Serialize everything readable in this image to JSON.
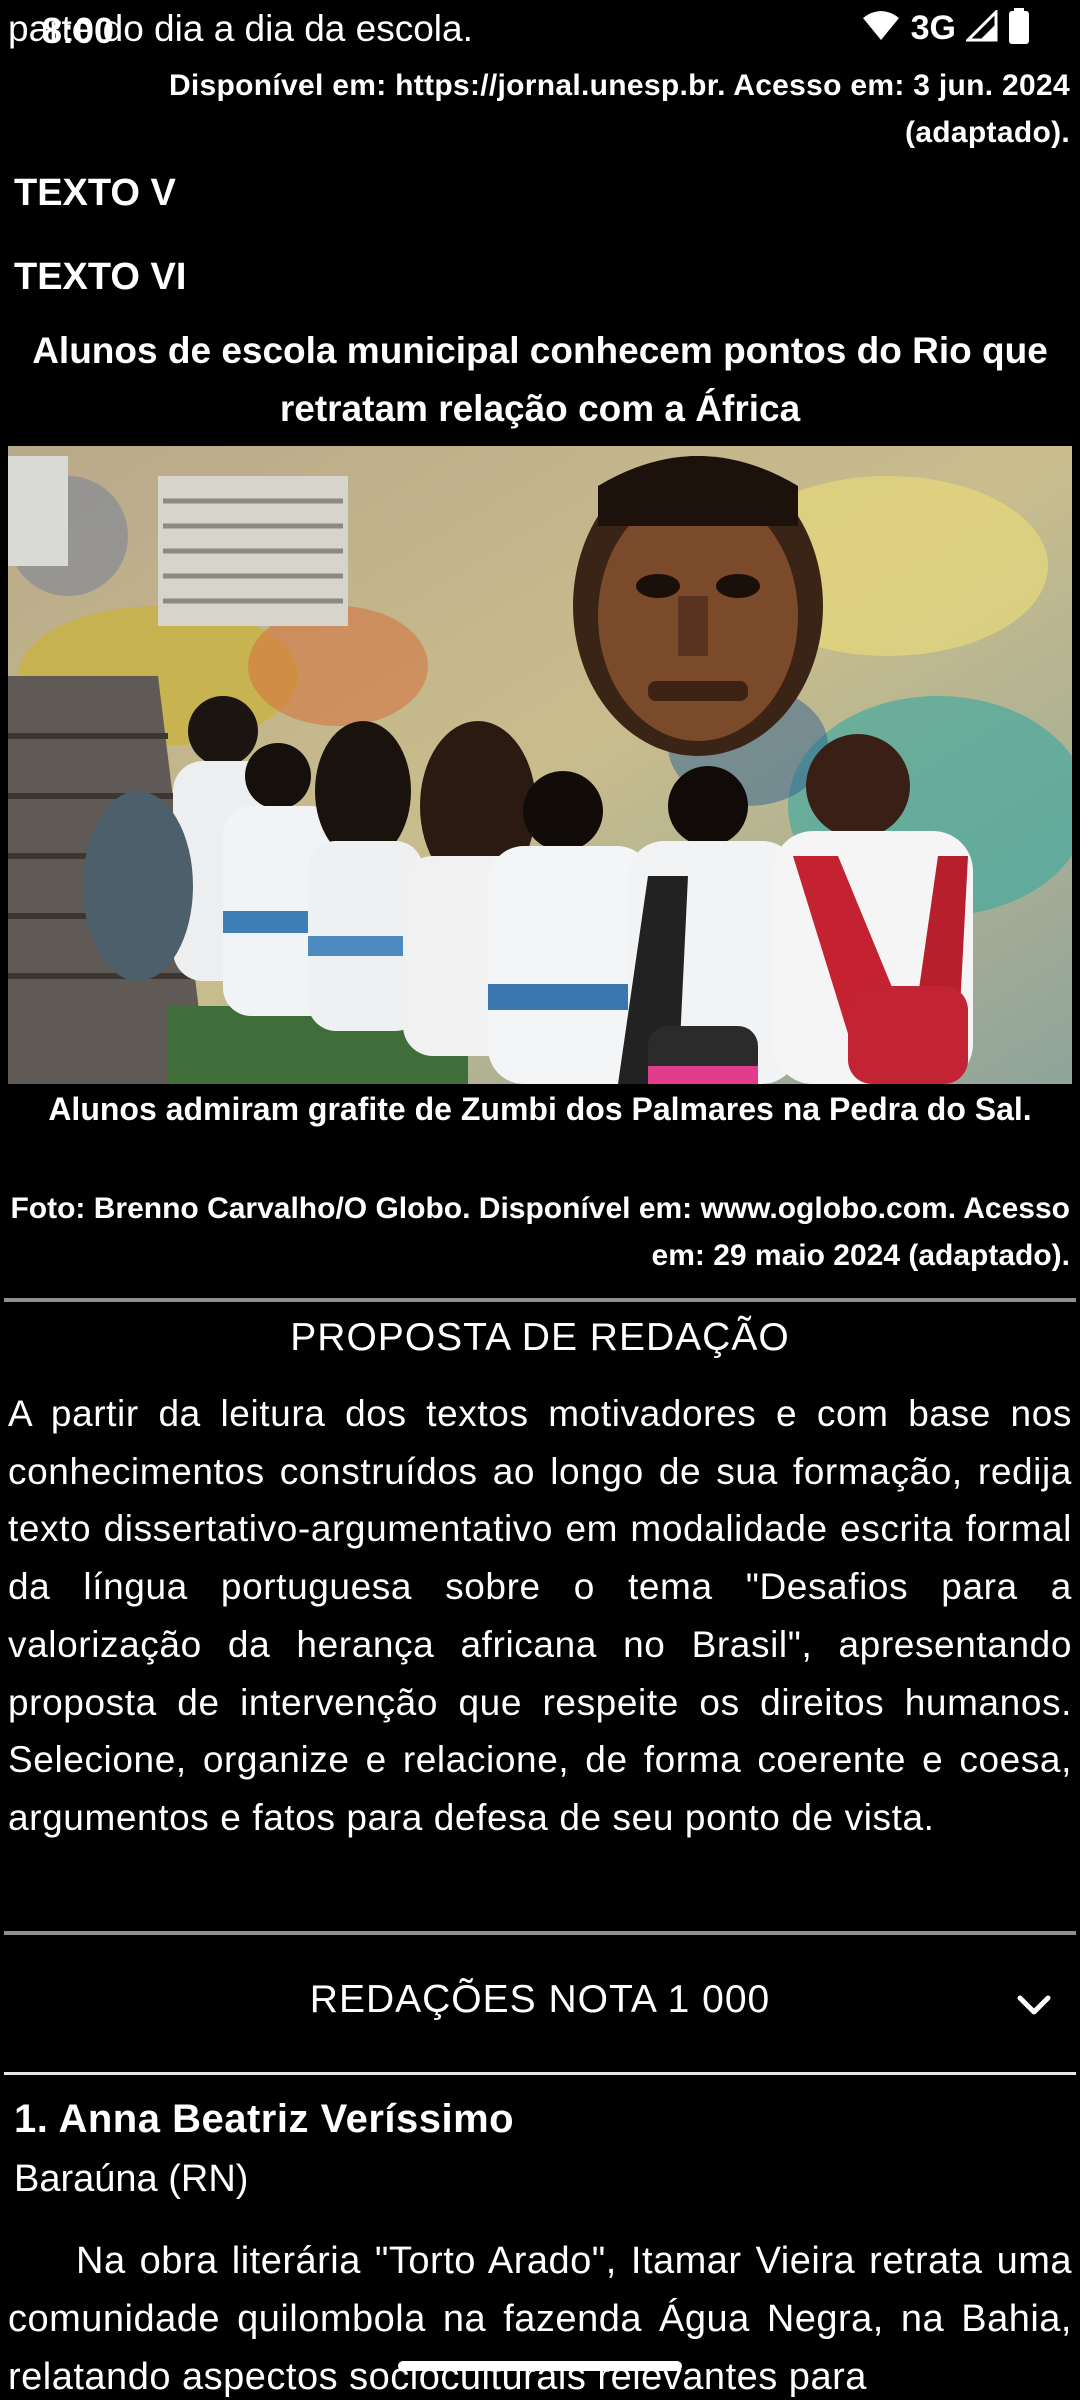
{
  "status_bar": {
    "time": "8:00",
    "network": "3G"
  },
  "top": {
    "partial_line": "parte do dia a dia da escola.",
    "source": "Disponível em: https://jornal.unesp.br. Acesso em: 3 jun. 2024 (adaptado)."
  },
  "texts": {
    "texto_v": "TEXTO V",
    "texto_vi": "TEXTO VI"
  },
  "news": {
    "title": "Alunos de escola municipal conhecem pontos do Rio que retratam relação com a África",
    "caption": "Alunos admiram grafite de Zumbi dos Palmares na Pedra do Sal.",
    "credit": "Foto: Brenno Carvalho/O Globo. Disponível em: www.oglobo.com. Acesso em: 29 maio 2024 (adaptado)."
  },
  "proposal": {
    "title": "PROPOSTA DE REDAÇÃO",
    "body": "A partir da leitura dos textos motivadores e com base nos conhecimentos construídos ao longo de sua formação, redija texto dissertativo-argumentativo em modalidade escrita formal da língua portuguesa sobre o tema \"Desafios para a valorização da herança africana no Brasil\", apresentando proposta de intervenção que respeite os direitos humanos. Selecione, organize e relacione, de forma coerente e coesa, argumentos e fatos para defesa de seu ponto de vista."
  },
  "essays_section": {
    "label": "REDAÇÕES NOTA 1 000"
  },
  "essay": {
    "author": "1. Anna Beatriz Veríssimo",
    "city": "Baraúna (RN)",
    "text": "Na obra literária \"Torto Arado\", Itamar Vieira retrata uma comunidade quilombola na fazenda Água Negra, na Bahia, relatando aspectos socioculturais relevantes para"
  },
  "icons": {
    "wifi": "wifi-icon",
    "signal": "signal-icon",
    "battery": "battery-icon",
    "chevron": "chevron-down-icon"
  },
  "colors": {
    "background": "#000000",
    "text": "#ffffff",
    "divider": "#8f8f8f"
  }
}
